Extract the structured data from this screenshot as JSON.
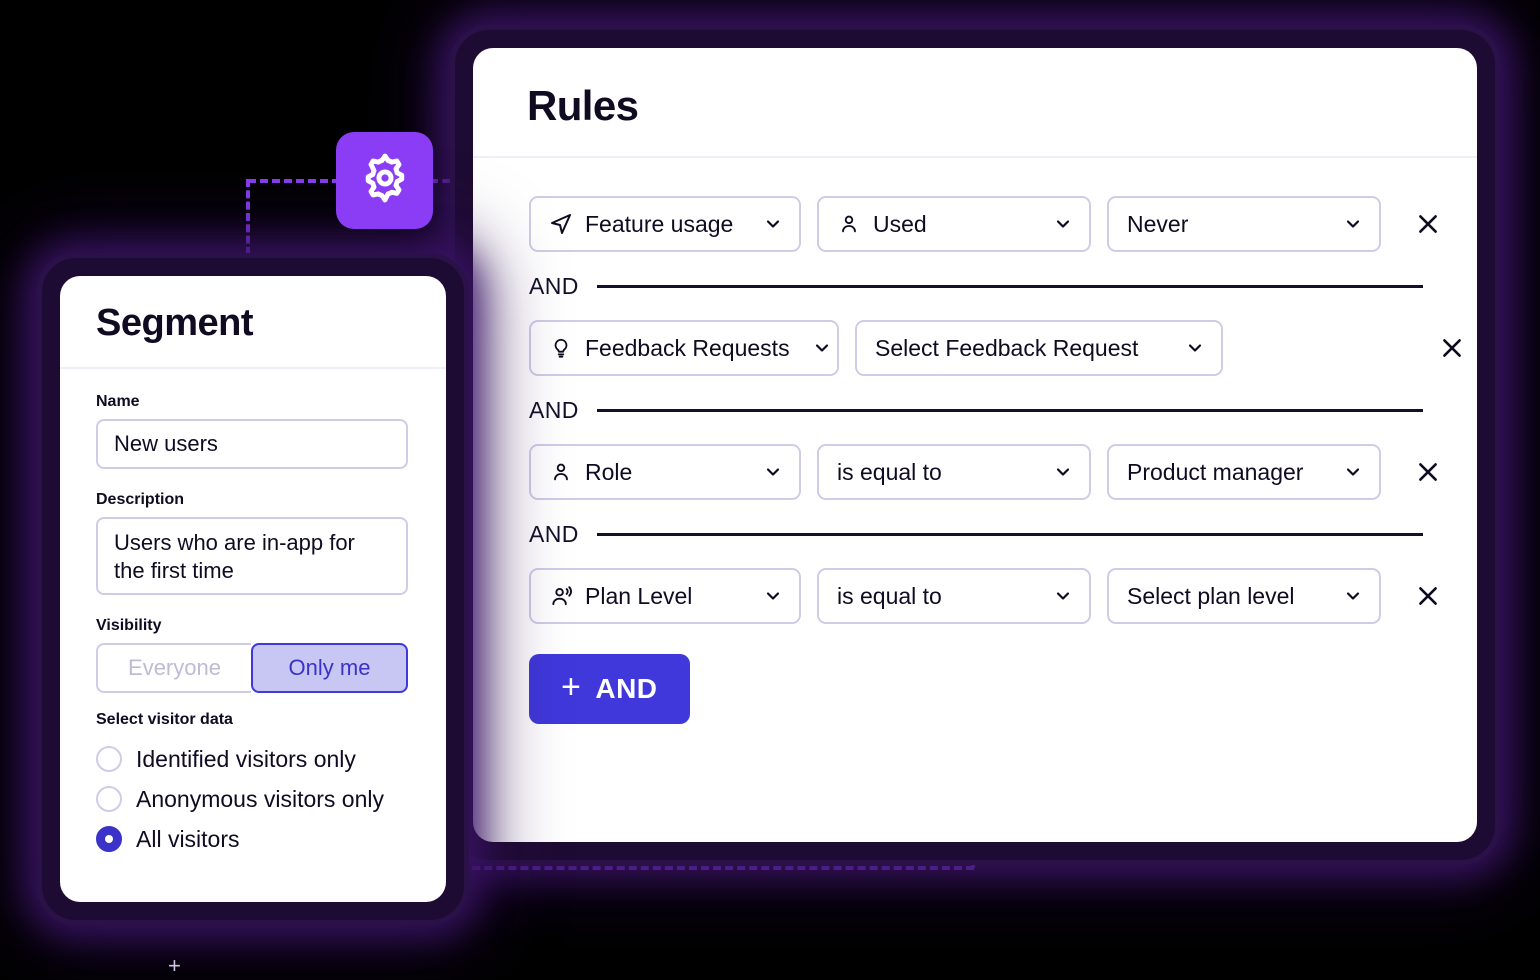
{
  "rules_panel": {
    "title": "Rules",
    "rows": [
      {
        "type_icon": "navigation-arrow-icon",
        "type_label": "Feature usage",
        "operator_icon": "person-icon",
        "operator_label": "Used",
        "value_label": "Never",
        "remove_label": "×"
      },
      {
        "type_icon": "lightbulb-icon",
        "type_label": "Feedback Requests",
        "value_label": "Select Feedback Request",
        "remove_label": "×"
      },
      {
        "type_icon": "person-icon",
        "type_label": "Role",
        "operator_label": "is equal to",
        "value_label": "Product manager",
        "remove_label": "×"
      },
      {
        "type_icon": "person-broadcast-icon",
        "type_label": "Plan Level",
        "operator_label": "is equal to",
        "value_label": "Select plan level",
        "remove_label": "×"
      }
    ],
    "and_separator_label": "AND",
    "add_button": {
      "plus": "+",
      "label": "AND"
    }
  },
  "segment_panel": {
    "title": "Segment",
    "name": {
      "label": "Name",
      "value": "New users"
    },
    "description": {
      "label": "Description",
      "value": "Users who are in-app for the first time"
    },
    "visibility": {
      "label": "Visibility",
      "options": [
        {
          "label": "Everyone",
          "selected": false
        },
        {
          "label": "Only me",
          "selected": true
        }
      ]
    },
    "visitor_data": {
      "label": "Select visitor data",
      "options": [
        {
          "label": "Identified visitors only",
          "selected": false
        },
        {
          "label": "Anonymous visitors only",
          "selected": false
        },
        {
          "label": "All visitors",
          "selected": true
        }
      ]
    }
  },
  "gear_badge": {
    "icon": "gear-icon"
  },
  "plus_marker": {
    "glyph": "+"
  },
  "colors": {
    "accent_indigo": "#4038DB",
    "accent_purple": "#8B3DF5",
    "toggle_active_bg": "#C8C6F2",
    "border_lavender": "#CFCCE8",
    "text_dark": "#110B22",
    "panel_glow": "#2A1147",
    "page_bg": "#000000"
  }
}
